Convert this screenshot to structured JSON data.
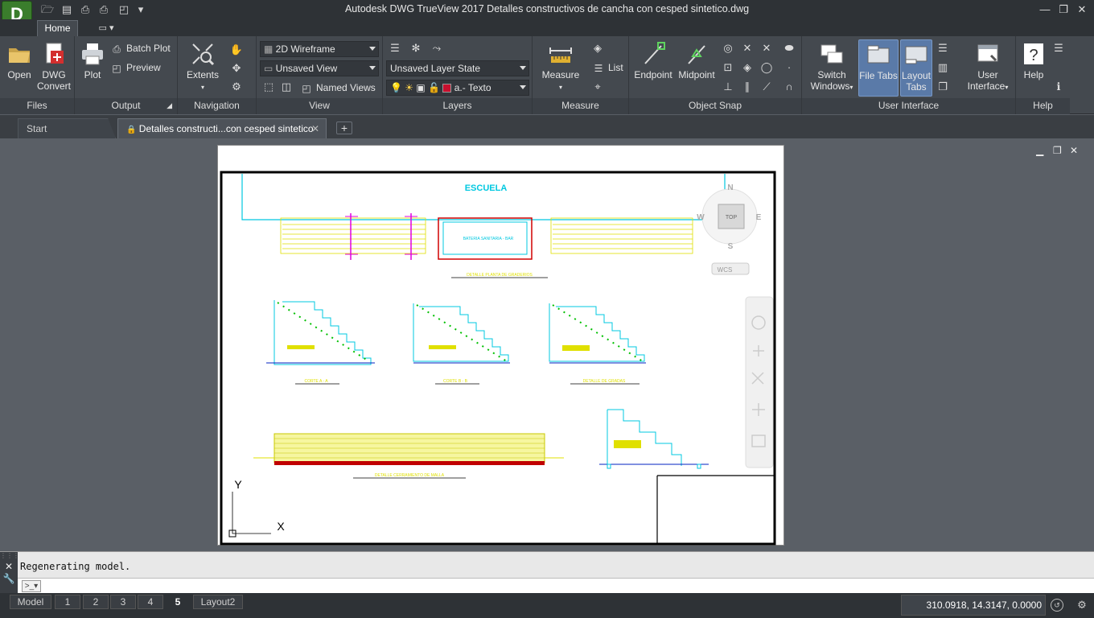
{
  "app": {
    "logo_letter": "D",
    "title": "Autodesk DWG TrueView 2017    Detalles constructivos de cancha con cesped sintetico.dwg"
  },
  "ribbon_tabs": {
    "home": "Home"
  },
  "files": {
    "open": "Open",
    "dwg_convert_1": "DWG",
    "dwg_convert_2": "Convert",
    "title": "Files"
  },
  "output": {
    "plot": "Plot",
    "batch_plot": "Batch Plot",
    "preview": "Preview",
    "title": "Output"
  },
  "navigation": {
    "extents": "Extents",
    "title": "Navigation"
  },
  "view": {
    "visual_style": "2D Wireframe",
    "named_view": "Unsaved View",
    "named_views": "Named Views",
    "title": "View"
  },
  "layers": {
    "layer_state": "Unsaved Layer State",
    "current_layer": "a.- Texto",
    "layer_color": "#c8102e",
    "title": "Layers"
  },
  "measure": {
    "measure": "Measure",
    "list": "List",
    "title": "Measure"
  },
  "osnap": {
    "endpoint": "Endpoint",
    "midpoint": "Midpoint",
    "title": "Object Snap"
  },
  "ui": {
    "switch_1": "Switch",
    "switch_2": "Windows",
    "file_tabs_1": "File Tabs",
    "layout_tabs_1": "Layout",
    "layout_tabs_2": "Tabs",
    "user_1": "User",
    "user_2": "Interface",
    "title": "User Interface"
  },
  "help": {
    "help": "Help",
    "title": "Help"
  },
  "doc_tabs": {
    "start": "Start",
    "file": "Detalles constructi...con cesped sintetico"
  },
  "drawing": {
    "escuela": "ESCUELA",
    "bateria": "BATERIA SANITARIA - BAR",
    "planta_label": "DETALLE PLANTA DE GRADERIOS",
    "corte_a": "CORTE  A - A",
    "corte_b": "CORTE  B - B",
    "detalle_gradas": "DETALLE DE GRADAS",
    "cerramiento": "DETALLE CERRAMIENTO DE MALLA",
    "compass": {
      "n": "N",
      "s": "S",
      "e": "E",
      "w": "W",
      "top": "TOP",
      "wcs": "WCS"
    },
    "ucs": {
      "x": "X",
      "y": "Y"
    }
  },
  "command": {
    "output": "Regenerating model."
  },
  "layout_tabs": [
    "Model",
    "1",
    "2",
    "3",
    "4",
    "5",
    "Layout2"
  ],
  "status": {
    "coords": "310.0918, 14.3147, 0.0000"
  }
}
